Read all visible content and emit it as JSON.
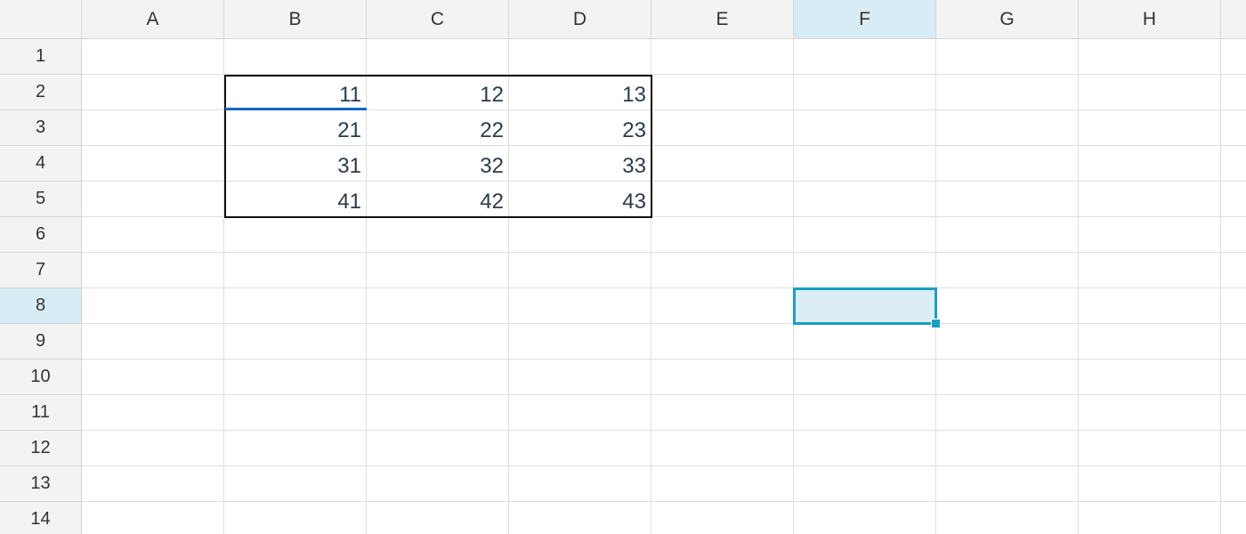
{
  "spreadsheet": {
    "columns": [
      "A",
      "B",
      "C",
      "D",
      "E",
      "F",
      "G",
      "H"
    ],
    "rows": [
      "1",
      "2",
      "3",
      "4",
      "5",
      "6",
      "7",
      "8",
      "9",
      "10",
      "11",
      "12",
      "13",
      "14"
    ],
    "active_column": "F",
    "active_row": "8",
    "selected_cell": "F8",
    "cells": {
      "B2": "11",
      "C2": "12",
      "D2": "13",
      "B3": "21",
      "C3": "22",
      "D3": "23",
      "B4": "31",
      "C4": "32",
      "D4": "33",
      "B5": "41",
      "C5": "42",
      "D5": "43"
    },
    "colors": {
      "header_bg": "#f3f3f3",
      "active_header_bg": "#d7ecf4",
      "selection_border": "#1b9fc6",
      "selection_fill": "#dbeef5",
      "table_border": "#111111",
      "cell_underline": "#1565c0",
      "text": "#2d3a4b"
    }
  }
}
